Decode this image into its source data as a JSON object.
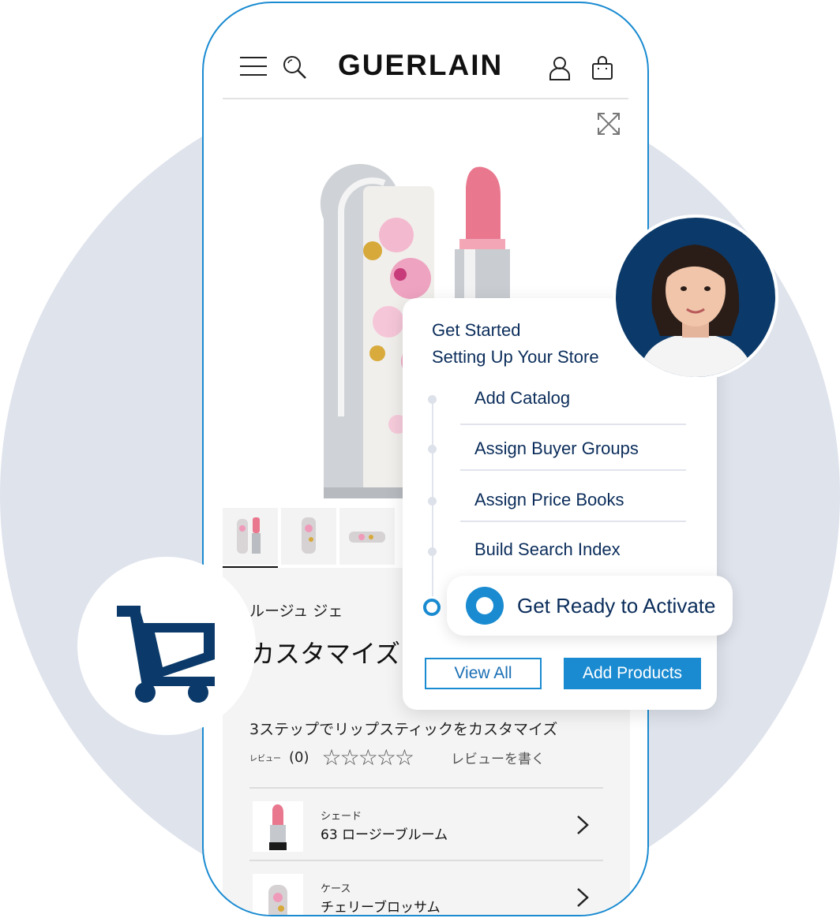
{
  "store": {
    "brand": "GUERLAIN",
    "product": {
      "subtitle": "ルージュ ジェ",
      "title": "カスタマイズリップ",
      "tagline": "3ステップでリップスティックをカスタマイズ",
      "review_label": "レビュー",
      "review_count": "(0)",
      "stars": "☆☆☆☆☆",
      "write_review": "レビューを書く"
    },
    "variants": [
      {
        "label": "シェード",
        "value": "63 ロージーブルーム"
      },
      {
        "label": "ケース",
        "value": "チェリーブロッサム"
      }
    ]
  },
  "onboarding": {
    "heading_line1": "Get Started",
    "heading_line2": "Setting Up Your Store",
    "steps": [
      "Add Catalog",
      "Assign Buyer Groups",
      "Assign Price Books",
      "Build Search Index"
    ],
    "active_step": "Get Ready to Activate",
    "view_all_label": "View All",
    "add_products_label": "Add Products"
  },
  "colors": {
    "accent": "#1a8bd1",
    "navy": "#0b2d5b",
    "background_circle": "#dfe3ec"
  },
  "icons": [
    "menu-icon",
    "search-icon",
    "user-icon",
    "bag-icon",
    "expand-icon",
    "shopping-cart-icon",
    "chevron-right-icon"
  ]
}
